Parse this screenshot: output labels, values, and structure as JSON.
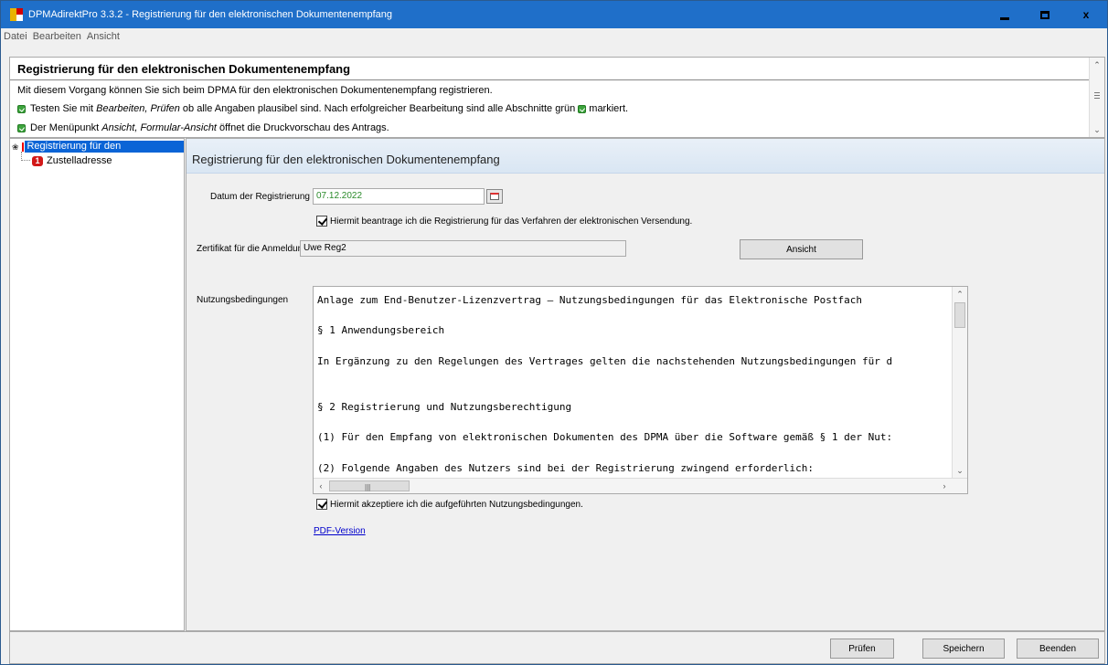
{
  "window": {
    "title": "DPMAdirektPro 3.3.2 - Registrierung für den elektronischen Dokumentenempfang",
    "accent_color": "#1f6fc9",
    "buttons": {
      "minimize": "minimize-icon",
      "maximize": "maximize-icon",
      "close": "x"
    }
  },
  "menu": [
    "Datei",
    "Bearbeiten",
    "Ansicht"
  ],
  "info": {
    "title": "Registrierung für den elektronischen Dokumentenempfang",
    "line1": "Mit diesem Vorgang können Sie sich beim DPMA für den elektronischen Dokumentenempfang registrieren.",
    "line2_pre": "Testen Sie mit ",
    "line2_em": "Bearbeiten, Prüfen",
    "line2_post": " ob alle Angaben plausibel sind. Nach erfolgreicher Bearbeitung sind alle Abschnitte grün",
    "line2_end": " markiert.",
    "line3_pre": "Der Menüpunkt ",
    "line3_em": "Ansicht, Formular-Ansicht",
    "line3_post": " öffnet die Druckvorschau des Antrags."
  },
  "tree": {
    "root": "Registrierung für den elektronischen",
    "child": "Zustelladresse",
    "child_badge": "1"
  },
  "main": {
    "header": "Registrierung für den elektronischen Dokumentenempfang",
    "date_label": "Datum der Registrierung",
    "date_value": "07.12.2022",
    "apply_checkbox": "Hiermit beantrage ich die Registrierung für das Verfahren der elektronischen Versendung.",
    "cert_label": "Zertifikat für die Anmeldung",
    "cert_value": "Uwe Reg2",
    "view_button": "Ansicht",
    "terms_label": "Nutzungsbedingungen",
    "terms_lines": [
      "Anlage zum End-Benutzer-Lizenzvertrag – Nutzungsbedingungen für das Elektronische Postfach",
      "§ 1 Anwendungsbereich",
      "In Ergänzung zu den Regelungen des Vertrages gelten die nachstehenden Nutzungsbedingungen für d",
      "§ 2 Registrierung und Nutzungsberechtigung",
      "(1) Für den Empfang von elektronischen Dokumenten des DPMA über die Software gemäß § 1 der Nut:",
      "(2) Folgende Angaben des Nutzers sind bei der Registrierung zwingend erforderlich:"
    ],
    "accept_checkbox": "Hiermit akzeptiere ich die aufgeführten Nutzungsbedingungen.",
    "pdf_link": "PDF-Version"
  },
  "footer": {
    "check": "Prüfen",
    "save": "Speichern",
    "quit": "Beenden"
  }
}
